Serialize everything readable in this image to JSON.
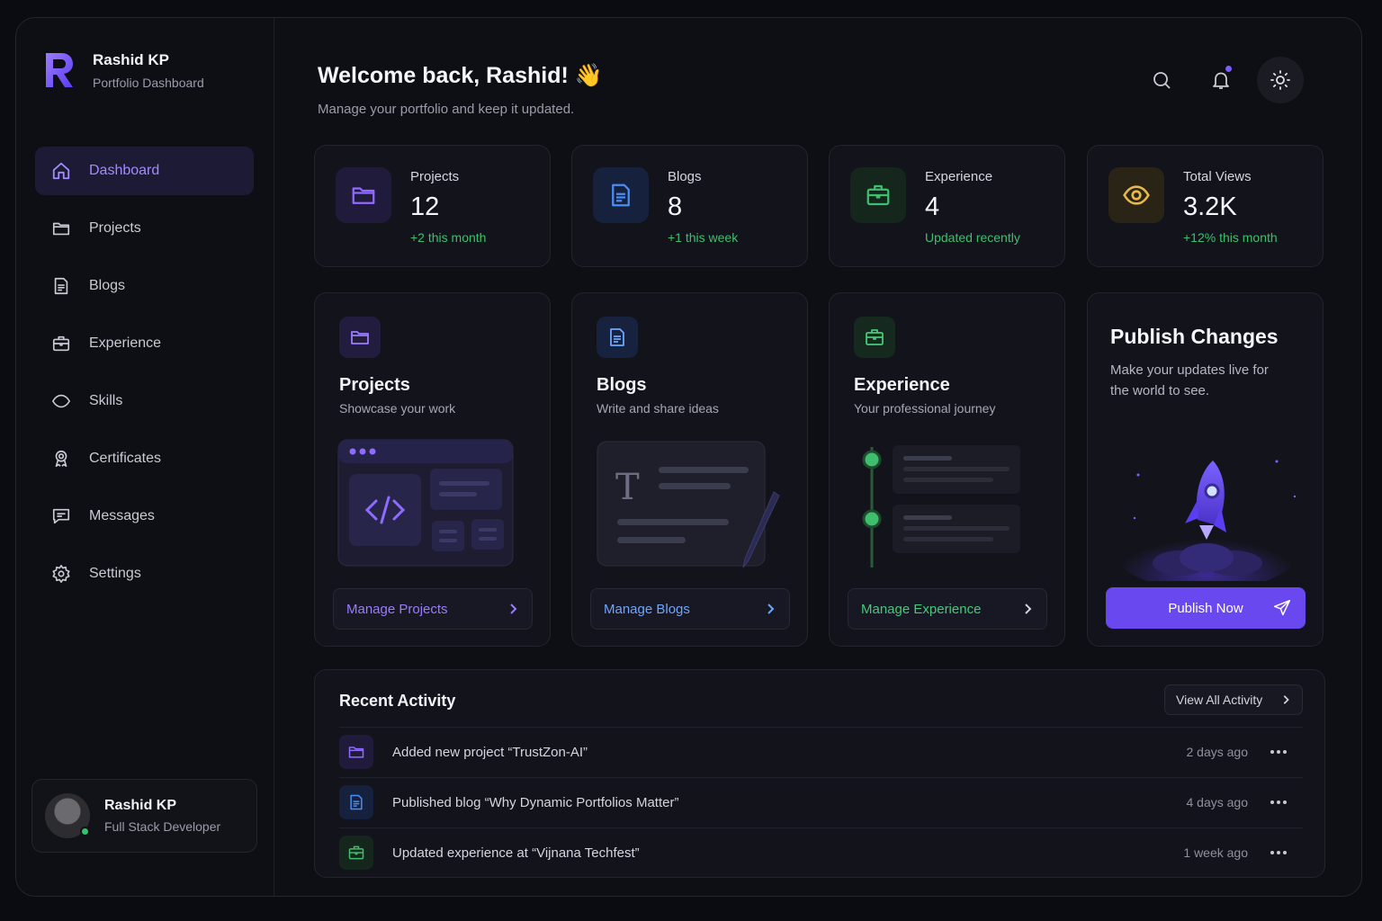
{
  "brand": {
    "name": "Rashid KP",
    "subtitle": "Portfolio Dashboard"
  },
  "nav": [
    {
      "label": "Dashboard",
      "icon": "home-icon",
      "active": true
    },
    {
      "label": "Projects",
      "icon": "folder-icon"
    },
    {
      "label": "Blogs",
      "icon": "document-icon"
    },
    {
      "label": "Experience",
      "icon": "briefcase-icon"
    },
    {
      "label": "Skills",
      "icon": "eye-outline-icon"
    },
    {
      "label": "Certificates",
      "icon": "award-icon"
    },
    {
      "label": "Messages",
      "icon": "chat-icon"
    },
    {
      "label": "Settings",
      "icon": "gear-icon"
    }
  ],
  "profile": {
    "name": "Rashid KP",
    "role": "Full Stack Developer",
    "status": "online"
  },
  "header": {
    "title": "Welcome back, Rashid! 👋",
    "subtitle": "Manage your portfolio and keep it updated."
  },
  "stats": [
    {
      "label": "Projects",
      "value": "12",
      "sub": "+2 this month",
      "icon": "folder-icon",
      "color": "#8f6bff"
    },
    {
      "label": "Blogs",
      "value": "8",
      "sub": "+1 this week",
      "icon": "document-icon",
      "color": "#4b8cf5"
    },
    {
      "label": "Experience",
      "value": "4",
      "sub": "Updated recently",
      "icon": "briefcase-icon",
      "color": "#3fbf6d"
    },
    {
      "label": "Total Views",
      "value": "3.2K",
      "sub": "+12% this month",
      "icon": "eye-icon",
      "color": "#e6b94a"
    }
  ],
  "features": [
    {
      "title": "Projects",
      "subtitle": "Showcase your work",
      "button": "Manage Projects",
      "color": "#9b7bff"
    },
    {
      "title": "Blogs",
      "subtitle": "Write and share ideas",
      "button": "Manage Blogs",
      "color": "#6ea6ff"
    },
    {
      "title": "Experience",
      "subtitle": "Your professional journey",
      "button": "Manage Experience",
      "color": "#46c97a"
    }
  ],
  "publish": {
    "title": "Publish Changes",
    "subtitle": "Make your updates live for the world to see.",
    "button": "Publish Now"
  },
  "activity": {
    "title": "Recent Activity",
    "view_all": "View All Activity",
    "items": [
      {
        "text": "Added new project “TrustZon-AI”",
        "time": "2 days ago",
        "icon": "folder-icon"
      },
      {
        "text": "Published blog “Why Dynamic Portfolios Matter”",
        "time": "4 days ago",
        "icon": "document-icon"
      },
      {
        "text": "Updated experience at “Vijnana Techfest”",
        "time": "1 week ago",
        "icon": "briefcase-icon"
      }
    ]
  },
  "colors": {
    "accent": "#6a48f0",
    "purple": "#8f6bff",
    "blue": "#4b8cf5",
    "green": "#3fbf6d",
    "yellow": "#e6b94a"
  }
}
